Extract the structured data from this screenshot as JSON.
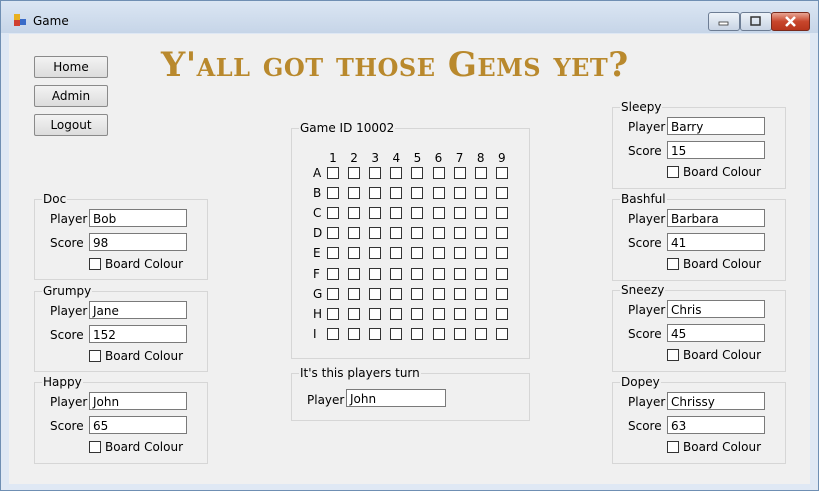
{
  "window": {
    "title": "Game"
  },
  "nav": {
    "home": "Home",
    "admin": "Admin",
    "logout": "Logout"
  },
  "heading": "Y'all got those Gems yet?",
  "labels": {
    "player": "Player",
    "score": "Score",
    "board_colour": "Board Colour"
  },
  "teams": {
    "doc": {
      "name": "Doc",
      "player": "Bob",
      "score": "98"
    },
    "grumpy": {
      "name": "Grumpy",
      "player": "Jane",
      "score": "152"
    },
    "happy": {
      "name": "Happy",
      "player": "John",
      "score": "65"
    },
    "sleepy": {
      "name": "Sleepy",
      "player": "Barry",
      "score": "15"
    },
    "bashful": {
      "name": "Bashful",
      "player": "Barbara",
      "score": "41"
    },
    "sneezy": {
      "name": "Sneezy",
      "player": "Chris",
      "score": "45"
    },
    "dopey": {
      "name": "Dopey",
      "player": "Chrissy",
      "score": "63"
    }
  },
  "game": {
    "title": "Game ID 10002",
    "columns": [
      "1",
      "2",
      "3",
      "4",
      "5",
      "6",
      "7",
      "8",
      "9"
    ],
    "rows": [
      "A",
      "B",
      "C",
      "D",
      "E",
      "F",
      "G",
      "H",
      "I"
    ]
  },
  "turn": {
    "title": "It's this players turn",
    "player_label": "Player",
    "player": "John"
  },
  "colors": {
    "heading": "#b9892d",
    "client_bg": "#f0f0f0"
  }
}
